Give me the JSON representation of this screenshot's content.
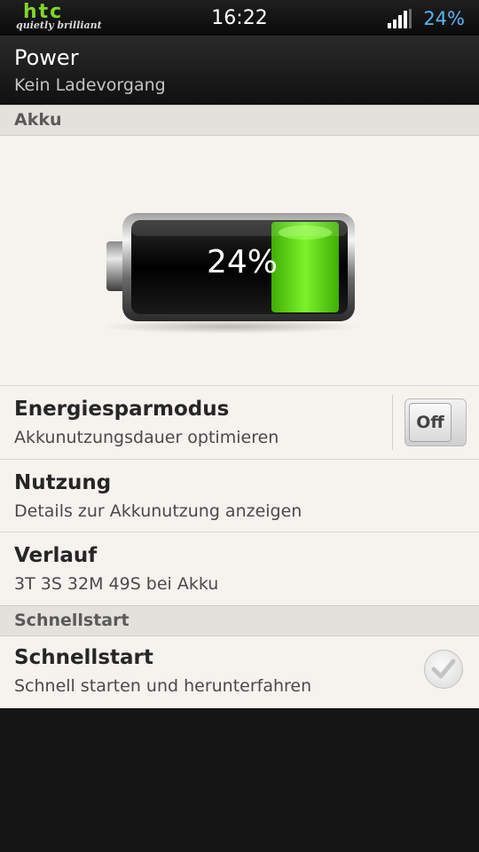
{
  "status_bar": {
    "brand_logo": "htc",
    "brand_tagline": "quietly brilliant",
    "time": "16:22",
    "battery_percent": "24%",
    "signal_icon": "signal-bars-icon"
  },
  "header": {
    "title": "Power",
    "subtitle": "Kein Ladevorgang"
  },
  "sections": {
    "akku": "Akku",
    "schnellstart": "Schnellstart"
  },
  "battery": {
    "level_label": "24%",
    "level_fraction": 0.24,
    "fill_color": "#58d40e"
  },
  "rows": {
    "energiesparmodus": {
      "title": "Energiesparmodus",
      "subtitle": "Akkunutzungsdauer optimieren",
      "toggle_label": "Off"
    },
    "nutzung": {
      "title": "Nutzung",
      "subtitle": "Details zur Akkunutzung anzeigen"
    },
    "verlauf": {
      "title": "Verlauf",
      "subtitle": "3T 3S 32M 49S bei Akku"
    },
    "schnellstart": {
      "title": "Schnellstart",
      "subtitle": "Schnell starten und herunterfahren"
    }
  },
  "colors": {
    "accent_blue": "#5ab4f0",
    "brand_green": "#7fd62a"
  }
}
